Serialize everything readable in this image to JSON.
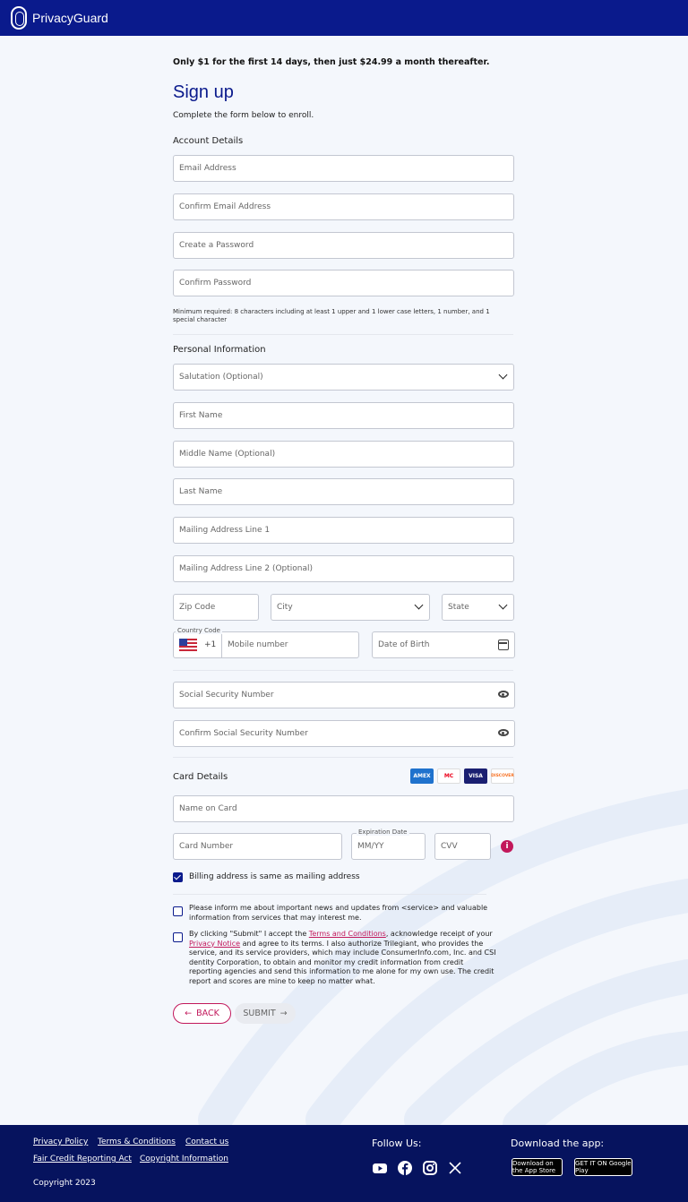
{
  "brand": {
    "name": "PrivacyGuard"
  },
  "promo": "Only $1 for the first 14 days, then just $24.99 a month thereafter.",
  "title": "Sign up",
  "subtitle": "Complete the form below to enroll.",
  "account": {
    "heading": "Account Details",
    "email": "Email Address",
    "confirm_email": "Confirm Email Address",
    "password": "Create a Password",
    "confirm_password": "Confirm Password",
    "hint": "Minimum required: 8 characters including at least 1 upper and 1 lower case letters, 1 number, and 1 special character"
  },
  "personal": {
    "heading": "Personal Information",
    "salutation": "Salutation (Optional)",
    "first_name": "First Name",
    "middle_name": "Middle Name (Optional)",
    "last_name": "Last Name",
    "address1": "Mailing Address Line 1",
    "address2": "Mailing Address Line 2 (Optional)",
    "zip": "Zip Code",
    "city": "City",
    "state": "State",
    "country_code_label": "Country Code",
    "country_code": "+1",
    "mobile": "Mobile number",
    "dob": "Date of Birth",
    "ssn": "Social Security Number",
    "confirm_ssn": "Confirm Social Security Number"
  },
  "card": {
    "heading": "Card Details",
    "brands": [
      "AMEX",
      "MC",
      "VISA",
      "DISCOVER"
    ],
    "brand_colors": [
      "#1f72cd",
      "#ffffff",
      "#1a1f71",
      "#ffffff"
    ],
    "name_on_card": "Name on Card",
    "card_number": "Card Number",
    "expiry_label": "Expiration Date",
    "expiry": "MM/YY",
    "cvv": "CVV",
    "info_icon": "i"
  },
  "checkboxes": {
    "billing_same": "Billing address is same as mailing address",
    "billing_checked": true,
    "newsletter": "Please inform me about important news and updates from <service> and valuable information from services that may interest me.",
    "terms_pre": "By clicking \"Submit\" I accept the ",
    "terms_link": "Terms and Conditions",
    "terms_mid": ", acknowledge receipt of your ",
    "privacy_link": "Privacy Notice",
    "terms_post": " and agree to its terms. I also authorize Trilegiant, who provides the service, and its service providers, which may include ConsumerInfo.com, Inc. and CSI dentity Corporation, to obtain and monitor my credit information from credit reporting agencies and send this information to me alone for my own use. The credit report and scores are mine to keep no matter what."
  },
  "buttons": {
    "back": "BACK",
    "submit": "SUBMIT"
  },
  "footer": {
    "links": [
      "Privacy Policy",
      "Terms & Conditions",
      "Contact us",
      "Fair Credit Reporting Act",
      "Copyright Information"
    ],
    "copyright": "Copyright 2023",
    "follow": "Follow Us:",
    "download": "Download the app:",
    "app_store": "Download on the App Store",
    "google_play": "GET IT ON Google Play"
  },
  "icons": [
    "fingerprint-logo-icon",
    "chevron-down-icon",
    "calendar-icon",
    "eye-icon",
    "us-flag-icon",
    "info-icon",
    "arrow-left-icon",
    "arrow-right-icon",
    "youtube-icon",
    "facebook-icon",
    "instagram-icon",
    "x-icon"
  ],
  "colors": {
    "primary": "#0a1a8c",
    "footer": "#06135e",
    "accent": "#c2185b"
  }
}
